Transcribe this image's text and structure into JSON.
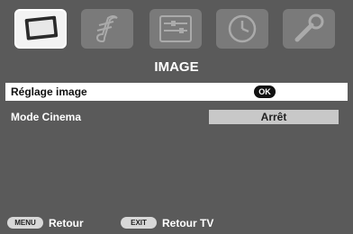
{
  "tabs": [
    {
      "name": "image-tab",
      "icon": "screen-icon",
      "active": true
    },
    {
      "name": "sound-tab",
      "icon": "music-note-icon",
      "active": false
    },
    {
      "name": "setup-tab",
      "icon": "equalizer-icon",
      "active": false
    },
    {
      "name": "timer-tab",
      "icon": "clock-icon",
      "active": false
    },
    {
      "name": "tools-tab",
      "icon": "wrench-icon",
      "active": false
    }
  ],
  "menu": {
    "title": "IMAGE",
    "items": [
      {
        "label": "Réglage image",
        "action": "OK"
      },
      {
        "label": "Mode Cinema",
        "value": "Arrêt"
      }
    ]
  },
  "footer": {
    "menu_key": "MENU",
    "menu_label": "Retour",
    "exit_key": "EXIT",
    "exit_label": "Retour TV"
  },
  "colors": {
    "background": "#5a5a5a",
    "selected_row": "#ffffff",
    "value_box": "#c8c8c8"
  }
}
